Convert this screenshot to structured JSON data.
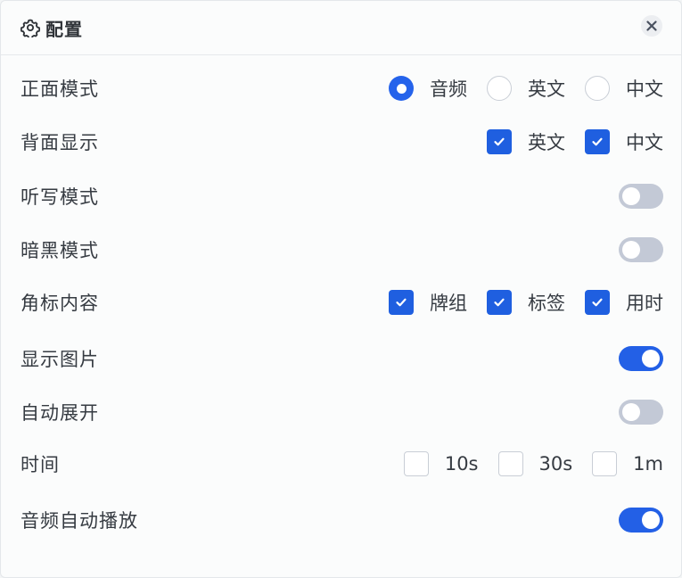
{
  "header": {
    "title": "配置"
  },
  "rows": {
    "front_mode": {
      "label": "正面模式",
      "options": [
        {
          "label": "音频",
          "selected": true
        },
        {
          "label": "英文",
          "selected": false
        },
        {
          "label": "中文",
          "selected": false
        }
      ]
    },
    "back_display": {
      "label": "背面显示",
      "options": [
        {
          "label": "英文",
          "checked": true
        },
        {
          "label": "中文",
          "checked": true
        }
      ]
    },
    "dictation_mode": {
      "label": "听写模式",
      "on": false
    },
    "dark_mode": {
      "label": "暗黑模式",
      "on": false
    },
    "badge_content": {
      "label": "角标内容",
      "options": [
        {
          "label": "牌组",
          "checked": true
        },
        {
          "label": "标签",
          "checked": true
        },
        {
          "label": "用时",
          "checked": true
        }
      ]
    },
    "show_images": {
      "label": "显示图片",
      "on": true
    },
    "auto_expand": {
      "label": "自动展开",
      "on": false
    },
    "time": {
      "label": "时间",
      "options": [
        {
          "label": "10s",
          "checked": false
        },
        {
          "label": "30s",
          "checked": false
        },
        {
          "label": "1m",
          "checked": false
        }
      ]
    },
    "audio_autoplay": {
      "label": "音频自动播放",
      "on": true
    }
  },
  "colors": {
    "accent": "#2563eb",
    "toggle_off": "#c3c9d6"
  },
  "icons": {
    "header": "gear-icon",
    "close": "close-icon",
    "check": "checkmark-icon"
  }
}
